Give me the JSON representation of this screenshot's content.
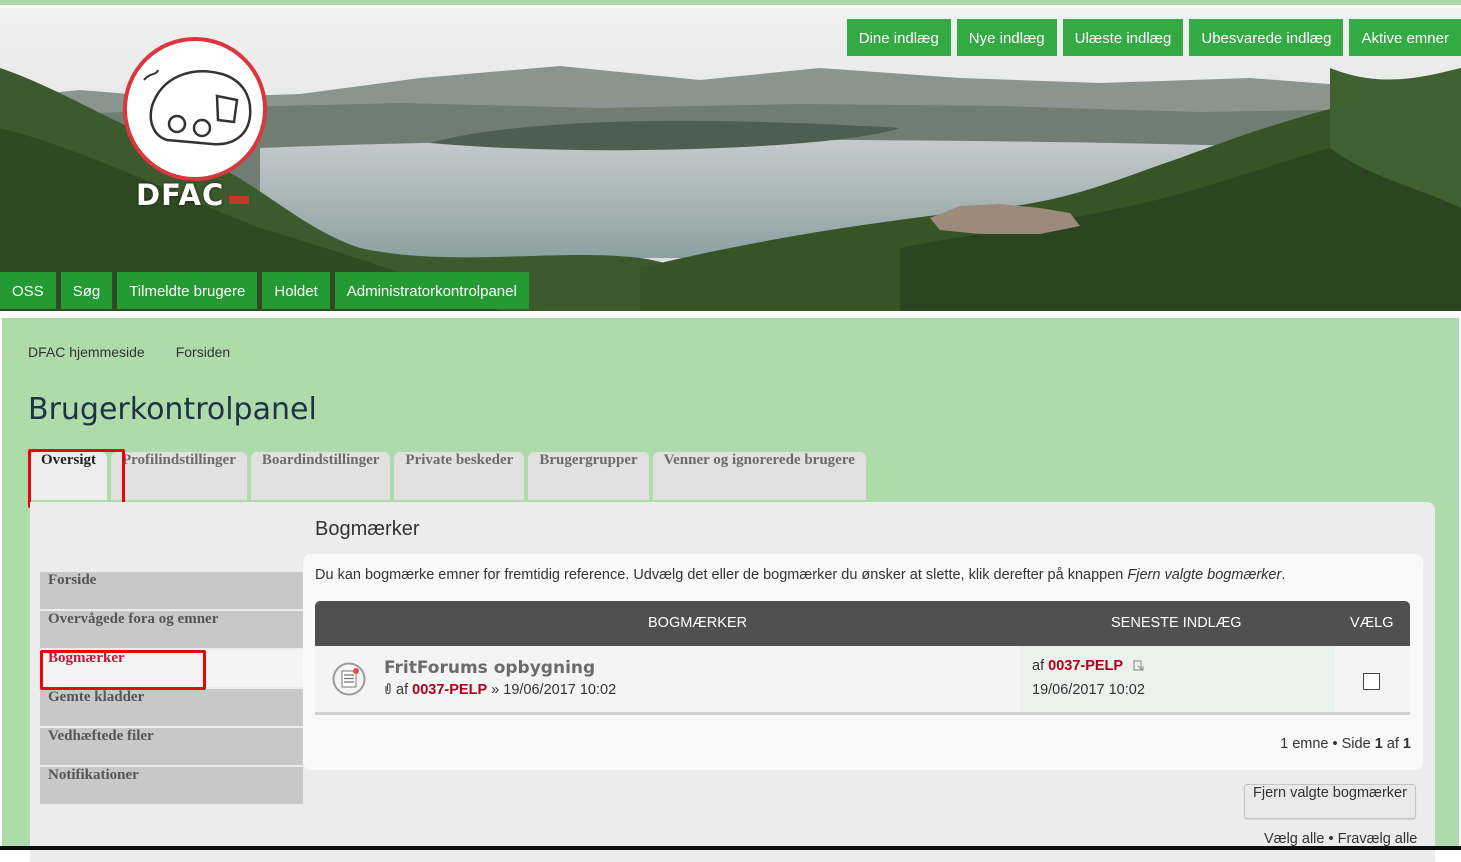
{
  "header": {
    "logo_text": "DFAC",
    "top_nav": [
      "Dine indlæg",
      "Nye indlæg",
      "Ulæste indlæg",
      "Ubesvarede indlæg",
      "Aktive emner"
    ],
    "bottom_nav": [
      "OSS",
      "Søg",
      "Tilmeldte brugere",
      "Holdet",
      "Administratorkontrolpanel"
    ]
  },
  "breadcrumb": [
    "DFAC hjemmeside",
    "Forsiden"
  ],
  "page_title": "Brugerkontrolpanel",
  "tabs": [
    "Oversigt",
    "Profilindstillinger",
    "Boardindstillinger",
    "Private beskeder",
    "Brugergrupper",
    "Venner og ignorerede brugere"
  ],
  "active_tab": "Oversigt",
  "sidebar": [
    "Forside",
    "Overvågede fora og emner",
    "Bogmærker",
    "Gemte kladder",
    "Vedhæftede filer",
    "Notifikationer"
  ],
  "active_sidebar": "Bogmærker",
  "section": {
    "title": "Bogmærker",
    "description": "Du kan bogmærke emner for fremtidig reference. Udvælg det eller de bogmærker du ønsker at slette, klik derefter på knappen ",
    "description_em": "Fjern valgte bogmærker",
    "description_end": "."
  },
  "table": {
    "col_topics": "BOGMÆRKER",
    "col_last": "SENESTE INDLÆG",
    "col_select": "VÆLG",
    "rows": [
      {
        "title": "FritForums opbygning",
        "by": "af",
        "author": "0037-PELP",
        "sep": "»",
        "date": "19/06/2017 10:02",
        "last_by": "af",
        "last_author": "0037-PELP",
        "last_date": "19/06/2017 10:02",
        "checked": false
      }
    ]
  },
  "pagination": {
    "count_text": "1 emne • Side",
    "page": "1",
    "of": "af",
    "total": "1"
  },
  "remove_button": "Fjern valgte bogmærker",
  "select_all": "Vælg alle",
  "bullet": "•",
  "deselect_all": "Fravælg alle",
  "colors": {
    "nav_green": "#33aa44",
    "page_green": "#aedbaa",
    "author_red": "#b0001e",
    "highlight_outline": "#e8060e"
  }
}
